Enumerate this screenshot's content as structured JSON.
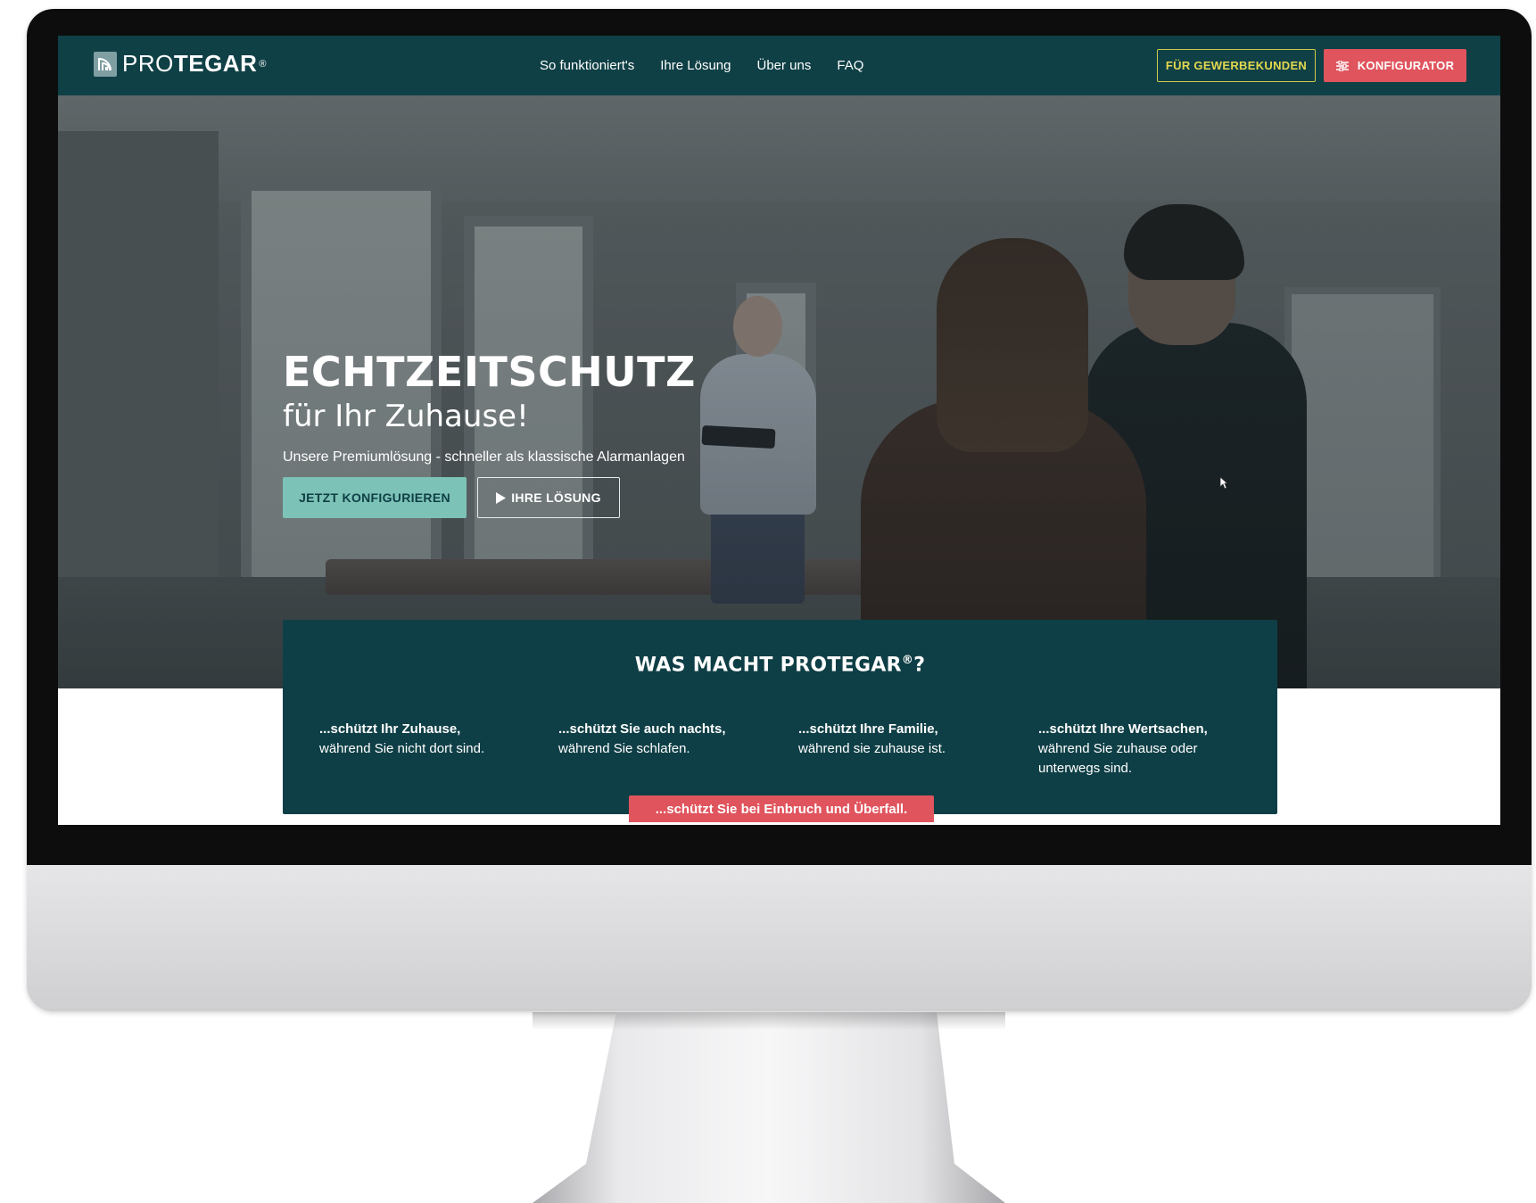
{
  "brand": {
    "logo_thin": "PRO",
    "logo_bold": "TEGAR",
    "logo_reg": "®"
  },
  "nav": {
    "links": [
      "So funktioniert's",
      "Ihre Lösung",
      "Über uns",
      "FAQ"
    ],
    "business_button": "FÜR GEWERBEKUNDEN",
    "configurator_button": "KONFIGURATOR"
  },
  "hero": {
    "title": "ECHTZEITSCHUTZ",
    "subtitle": "für Ihr Zuhause!",
    "description": "Unsere Premiumlösung -  schneller als klassische Alarmanlagen",
    "primary_button": "JETZT KONFIGURIEREN",
    "secondary_button": "IHRE LÖSUNG"
  },
  "info": {
    "title_prefix": "WAS MACHT PROTEGAR",
    "title_reg": "®",
    "title_suffix": "?",
    "features": [
      {
        "bold": "...schützt Ihr Zuhause,",
        "text": "während Sie nicht dort sind."
      },
      {
        "bold": "...schützt Sie auch nachts,",
        "text": "während Sie schlafen."
      },
      {
        "bold": "...schützt Ihre Familie,",
        "text": "während sie zuhause ist."
      },
      {
        "bold": "...schützt Ihre Wertsachen,",
        "text": "während Sie zuhause oder unterwegs sind."
      }
    ],
    "highlight": "...schützt Sie bei Einbruch und Überfall."
  },
  "colors": {
    "nav_bg": "#0f4046",
    "accent_red": "#e0545d",
    "accent_teal": "#7cc2b7",
    "accent_yellow": "#e3d84f"
  },
  "icons": {
    "logo": "protegar-signal-icon",
    "configurator": "sliders-icon",
    "secondary_button": "play-icon",
    "cursor": "mouse-cursor-icon"
  }
}
